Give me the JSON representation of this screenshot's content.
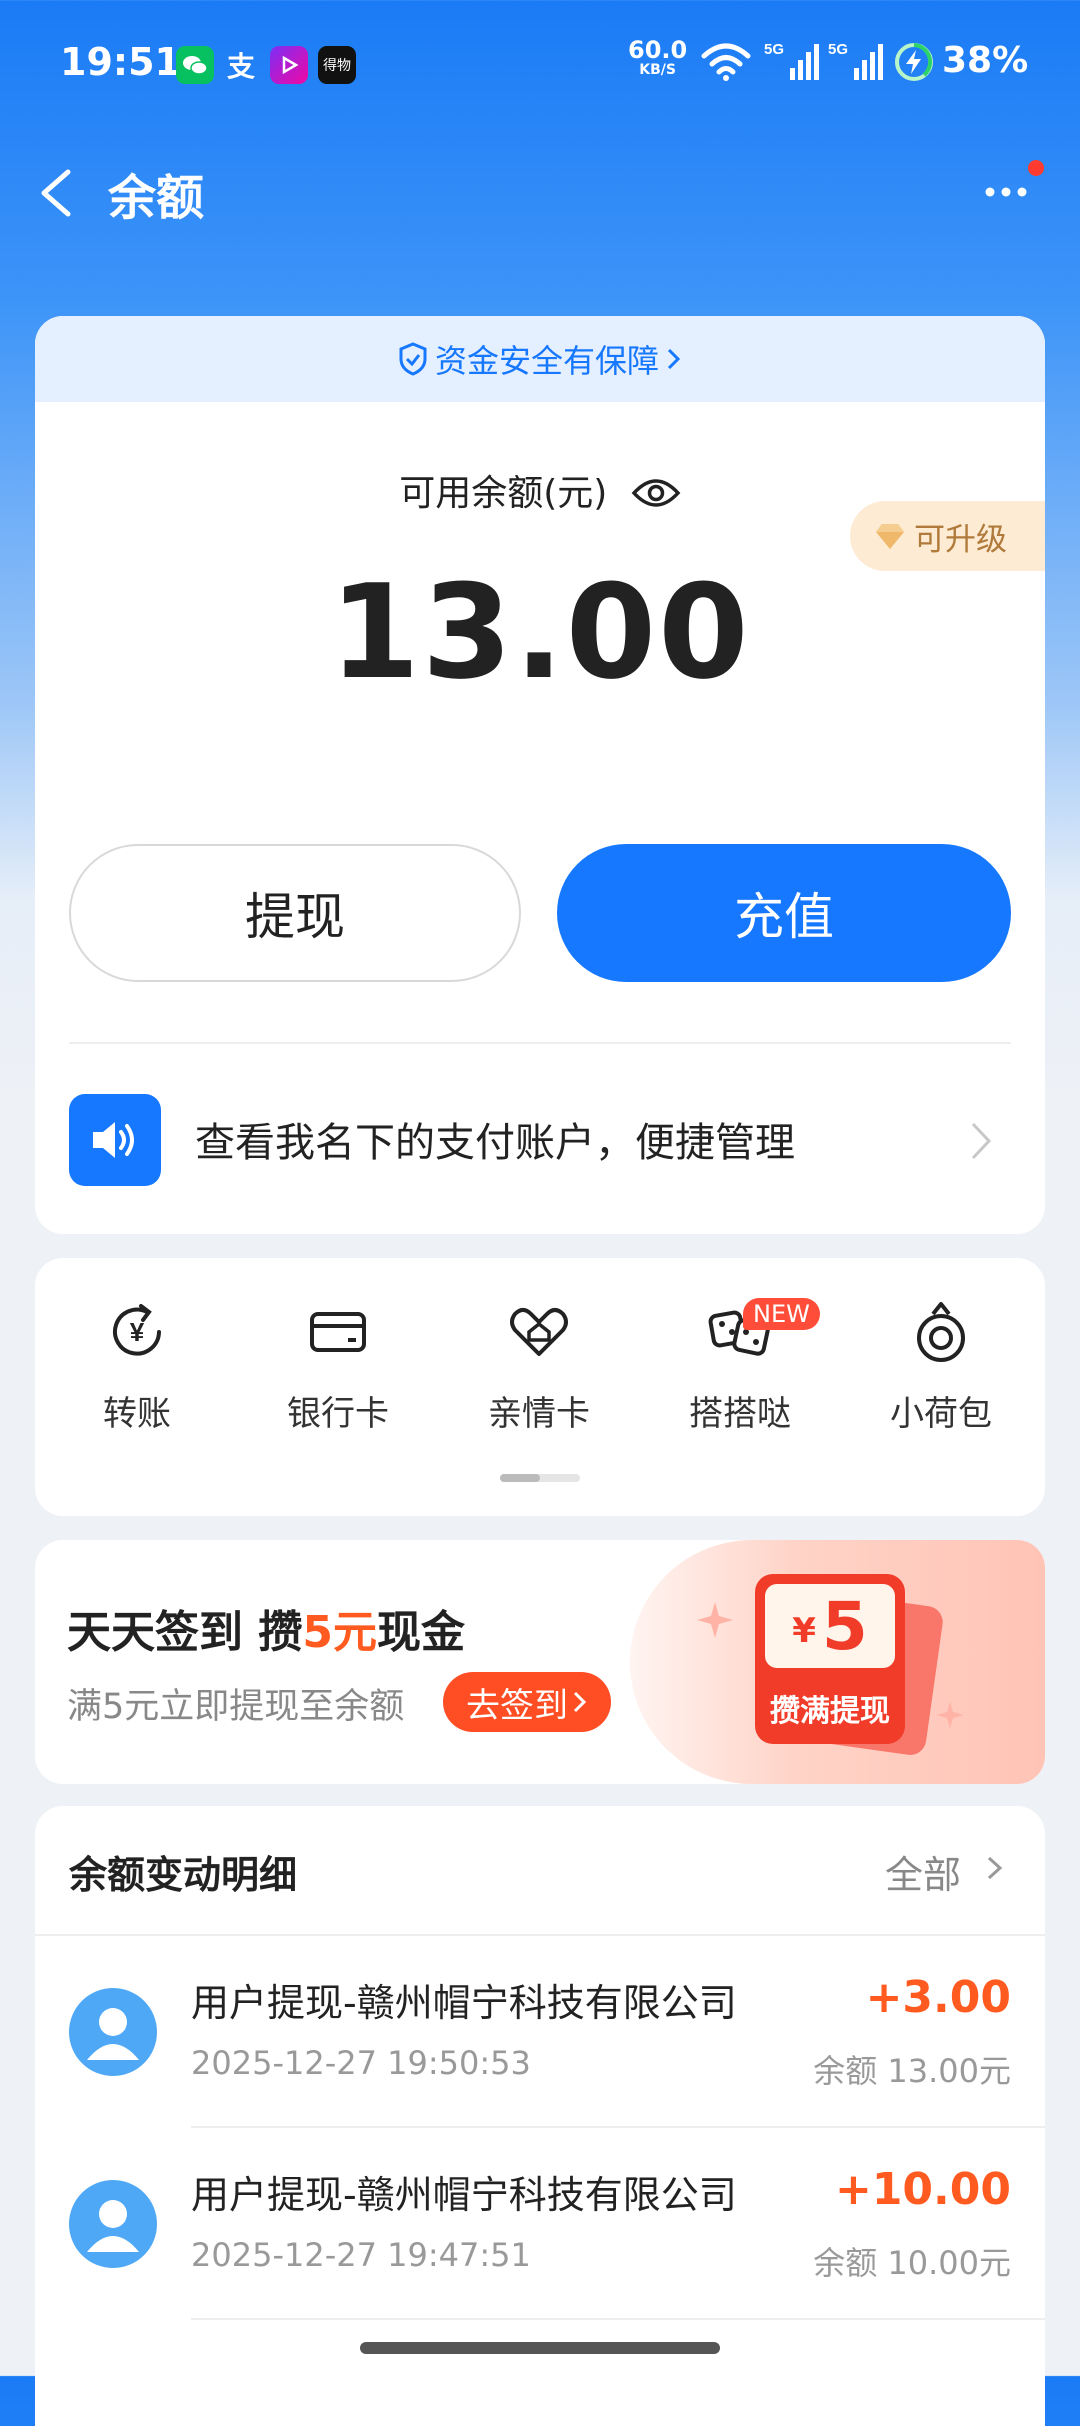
{
  "status_bar": {
    "time": "19:51",
    "app_icons": [
      "wechat-icon",
      "alipay-icon",
      "video-icon",
      "dewu-icon"
    ],
    "app_icon_labels": {
      "alipay": "支",
      "dewu": "得物"
    },
    "net_speed_value": "60.0",
    "net_speed_unit": "KB/S",
    "signal_label": "5G",
    "battery_percent": "38%"
  },
  "header": {
    "title": "余额"
  },
  "balance_card": {
    "safety_text": "资金安全有保障",
    "balance_label": "可用余额(元)",
    "balance_amount": "13.00",
    "upgrade_label": "可升级",
    "withdraw_label": "提现",
    "recharge_label": "充值",
    "notice_text": "查看我名下的支付账户，便捷管理"
  },
  "quick_actions": [
    {
      "label": "转账",
      "icon": "transfer-icon"
    },
    {
      "label": "银行卡",
      "icon": "bank-card-icon"
    },
    {
      "label": "亲情卡",
      "icon": "family-card-icon"
    },
    {
      "label": "搭搭哒",
      "icon": "dice-icon"
    },
    {
      "label": "小荷包",
      "icon": "purse-icon"
    }
  ],
  "new_badge": "NEW",
  "sign_banner": {
    "title_part1": "天天签到 攒",
    "title_highlight": "5元",
    "title_part2": "现金",
    "subtitle": "满5元立即提现至余额",
    "button_label": "去签到",
    "packet_currency": "¥",
    "packet_value": "5",
    "packet_label": "攒满提现"
  },
  "transactions": {
    "title": "余额变动明细",
    "filter_label": "全部",
    "items": [
      {
        "name": "用户提现-赣州帽宁科技有限公司",
        "time": "2025-12-27 19:50:53",
        "amount": "+3.00",
        "balance": "余额 13.00元"
      },
      {
        "name": "用户提现-赣州帽宁科技有限公司",
        "time": "2025-12-27 19:47:51",
        "amount": "+10.00",
        "balance": "余额 10.00元"
      }
    ]
  },
  "colors": {
    "primary": "#1677ff",
    "accent_orange": "#ff5a1f",
    "header_blue": "#1a7bf6"
  }
}
